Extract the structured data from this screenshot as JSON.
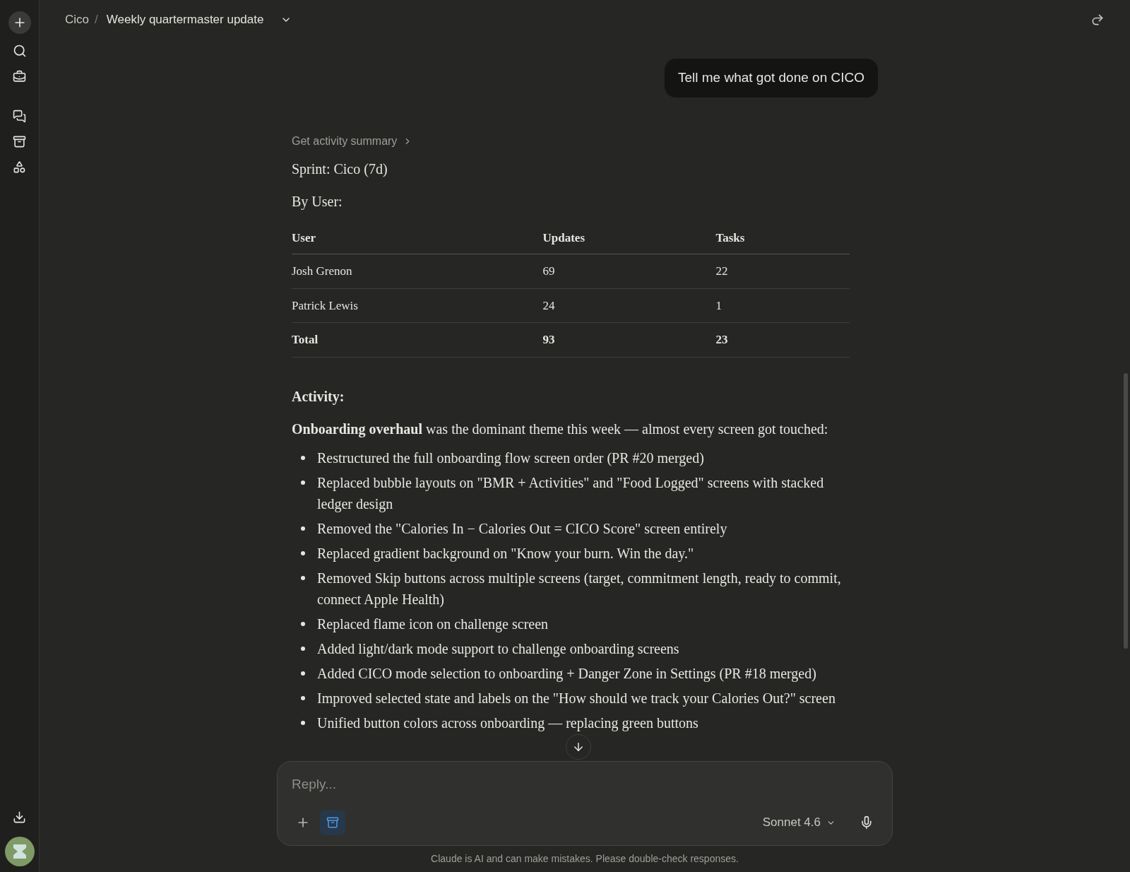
{
  "header": {
    "project": "Cico",
    "separator": "/",
    "title": "Weekly quartermaster update"
  },
  "user_message": "Tell me what got done on CICO",
  "response": {
    "tool_call": "Get activity summary",
    "sprint": "Sprint: Cico (7d)",
    "by_user_label": "By User:",
    "table": {
      "columns": [
        "User",
        "Updates",
        "Tasks"
      ],
      "rows": [
        {
          "kind": "data",
          "cells": [
            "Josh Grenon",
            "69",
            "22"
          ]
        },
        {
          "kind": "data",
          "cells": [
            "Patrick Lewis",
            "24",
            "1"
          ]
        },
        {
          "kind": "total",
          "cells": [
            "Total",
            "93",
            "23"
          ]
        }
      ]
    },
    "activity_heading": "Activity:",
    "intro": "**Onboarding overhaul** was the dominant theme this week — almost every screen got touched:",
    "bullets": [
      "Restructured the full onboarding flow screen order (PR #20 merged)",
      "Replaced bubble layouts on \"BMR + Activities\" and \"Food Logged\" screens with stacked ledger design",
      "Removed the \"Calories In − Calories Out = CICO Score\" screen entirely",
      "Replaced gradient background on \"Know your burn. Win the day.\"",
      "Removed Skip buttons across multiple screens (target, commitment length, ready to commit, connect Apple Health)",
      "Replaced flame icon on challenge screen",
      "Added light/dark mode support to challenge onboarding screens",
      "Added CICO mode selection to onboarding + Danger Zone in Settings (PR #18 merged)",
      "Improved selected state and labels on the \"How should we track your Calories Out?\" screen",
      "Unified button colors across onboarding — replacing green buttons"
    ]
  },
  "composer": {
    "placeholder": "Reply...",
    "tools_active": true,
    "model": "Sonnet 4.6"
  },
  "disclaimer": "Claude is AI and can make mistakes. Please double-check responses."
}
